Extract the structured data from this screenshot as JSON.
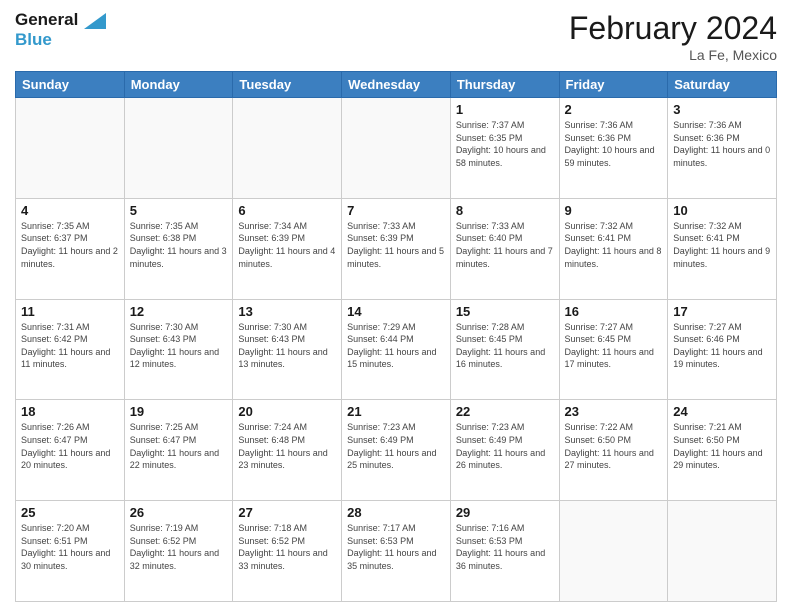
{
  "header": {
    "logo_line1": "General",
    "logo_line2": "Blue",
    "month_title": "February 2024",
    "subtitle": "La Fe, Mexico"
  },
  "days_of_week": [
    "Sunday",
    "Monday",
    "Tuesday",
    "Wednesday",
    "Thursday",
    "Friday",
    "Saturday"
  ],
  "weeks": [
    [
      {
        "day": "",
        "sunrise": "",
        "sunset": "",
        "daylight": ""
      },
      {
        "day": "",
        "sunrise": "",
        "sunset": "",
        "daylight": ""
      },
      {
        "day": "",
        "sunrise": "",
        "sunset": "",
        "daylight": ""
      },
      {
        "day": "",
        "sunrise": "",
        "sunset": "",
        "daylight": ""
      },
      {
        "day": "1",
        "sunrise": "7:37 AM",
        "sunset": "6:35 PM",
        "daylight": "10 hours and 58 minutes."
      },
      {
        "day": "2",
        "sunrise": "7:36 AM",
        "sunset": "6:36 PM",
        "daylight": "10 hours and 59 minutes."
      },
      {
        "day": "3",
        "sunrise": "7:36 AM",
        "sunset": "6:36 PM",
        "daylight": "11 hours and 0 minutes."
      }
    ],
    [
      {
        "day": "4",
        "sunrise": "7:35 AM",
        "sunset": "6:37 PM",
        "daylight": "11 hours and 2 minutes."
      },
      {
        "day": "5",
        "sunrise": "7:35 AM",
        "sunset": "6:38 PM",
        "daylight": "11 hours and 3 minutes."
      },
      {
        "day": "6",
        "sunrise": "7:34 AM",
        "sunset": "6:39 PM",
        "daylight": "11 hours and 4 minutes."
      },
      {
        "day": "7",
        "sunrise": "7:33 AM",
        "sunset": "6:39 PM",
        "daylight": "11 hours and 5 minutes."
      },
      {
        "day": "8",
        "sunrise": "7:33 AM",
        "sunset": "6:40 PM",
        "daylight": "11 hours and 7 minutes."
      },
      {
        "day": "9",
        "sunrise": "7:32 AM",
        "sunset": "6:41 PM",
        "daylight": "11 hours and 8 minutes."
      },
      {
        "day": "10",
        "sunrise": "7:32 AM",
        "sunset": "6:41 PM",
        "daylight": "11 hours and 9 minutes."
      }
    ],
    [
      {
        "day": "11",
        "sunrise": "7:31 AM",
        "sunset": "6:42 PM",
        "daylight": "11 hours and 11 minutes."
      },
      {
        "day": "12",
        "sunrise": "7:30 AM",
        "sunset": "6:43 PM",
        "daylight": "11 hours and 12 minutes."
      },
      {
        "day": "13",
        "sunrise": "7:30 AM",
        "sunset": "6:43 PM",
        "daylight": "11 hours and 13 minutes."
      },
      {
        "day": "14",
        "sunrise": "7:29 AM",
        "sunset": "6:44 PM",
        "daylight": "11 hours and 15 minutes."
      },
      {
        "day": "15",
        "sunrise": "7:28 AM",
        "sunset": "6:45 PM",
        "daylight": "11 hours and 16 minutes."
      },
      {
        "day": "16",
        "sunrise": "7:27 AM",
        "sunset": "6:45 PM",
        "daylight": "11 hours and 17 minutes."
      },
      {
        "day": "17",
        "sunrise": "7:27 AM",
        "sunset": "6:46 PM",
        "daylight": "11 hours and 19 minutes."
      }
    ],
    [
      {
        "day": "18",
        "sunrise": "7:26 AM",
        "sunset": "6:47 PM",
        "daylight": "11 hours and 20 minutes."
      },
      {
        "day": "19",
        "sunrise": "7:25 AM",
        "sunset": "6:47 PM",
        "daylight": "11 hours and 22 minutes."
      },
      {
        "day": "20",
        "sunrise": "7:24 AM",
        "sunset": "6:48 PM",
        "daylight": "11 hours and 23 minutes."
      },
      {
        "day": "21",
        "sunrise": "7:23 AM",
        "sunset": "6:49 PM",
        "daylight": "11 hours and 25 minutes."
      },
      {
        "day": "22",
        "sunrise": "7:23 AM",
        "sunset": "6:49 PM",
        "daylight": "11 hours and 26 minutes."
      },
      {
        "day": "23",
        "sunrise": "7:22 AM",
        "sunset": "6:50 PM",
        "daylight": "11 hours and 27 minutes."
      },
      {
        "day": "24",
        "sunrise": "7:21 AM",
        "sunset": "6:50 PM",
        "daylight": "11 hours and 29 minutes."
      }
    ],
    [
      {
        "day": "25",
        "sunrise": "7:20 AM",
        "sunset": "6:51 PM",
        "daylight": "11 hours and 30 minutes."
      },
      {
        "day": "26",
        "sunrise": "7:19 AM",
        "sunset": "6:52 PM",
        "daylight": "11 hours and 32 minutes."
      },
      {
        "day": "27",
        "sunrise": "7:18 AM",
        "sunset": "6:52 PM",
        "daylight": "11 hours and 33 minutes."
      },
      {
        "day": "28",
        "sunrise": "7:17 AM",
        "sunset": "6:53 PM",
        "daylight": "11 hours and 35 minutes."
      },
      {
        "day": "29",
        "sunrise": "7:16 AM",
        "sunset": "6:53 PM",
        "daylight": "11 hours and 36 minutes."
      },
      {
        "day": "",
        "sunrise": "",
        "sunset": "",
        "daylight": ""
      },
      {
        "day": "",
        "sunrise": "",
        "sunset": "",
        "daylight": ""
      }
    ]
  ]
}
